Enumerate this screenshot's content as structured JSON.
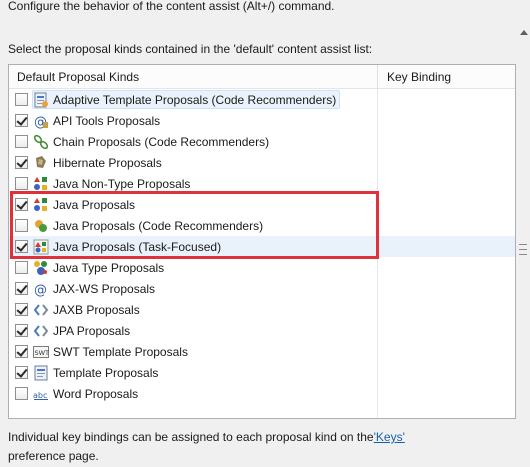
{
  "header_text": "Configure the behavior of the content assist (Alt+/) command.",
  "select_label": "Select the proposal kinds contained in the 'default' content assist list:",
  "columns": {
    "kinds": "Default Proposal Kinds",
    "binding": "Key Binding"
  },
  "proposals": [
    {
      "label": "Adaptive Template Proposals (Code Recommenders)",
      "checked": false,
      "icon": "template-icon"
    },
    {
      "label": "API Tools Proposals",
      "checked": true,
      "icon": "api-tools-icon"
    },
    {
      "label": "Chain Proposals (Code Recommenders)",
      "checked": false,
      "icon": "chain-icon"
    },
    {
      "label": "Hibernate Proposals",
      "checked": true,
      "icon": "hibernate-icon"
    },
    {
      "label": "Java Non-Type Proposals",
      "checked": false,
      "icon": "java-shapes-icon"
    },
    {
      "label": "Java Proposals",
      "checked": true,
      "icon": "java-shapes-icon"
    },
    {
      "label": "Java Proposals (Code Recommenders)",
      "checked": false,
      "icon": "recommenders-icon"
    },
    {
      "label": "Java Proposals (Task-Focused)",
      "checked": true,
      "icon": "task-focused-icon"
    },
    {
      "label": "Java Type Proposals",
      "checked": false,
      "icon": "java-type-icon"
    },
    {
      "label": "JAX-WS Proposals",
      "checked": true,
      "icon": "jaxws-icon"
    },
    {
      "label": "JAXB Proposals",
      "checked": true,
      "icon": "jaxb-icon"
    },
    {
      "label": "JPA Proposals",
      "checked": true,
      "icon": "jpa-icon"
    },
    {
      "label": "SWT Template Proposals",
      "checked": true,
      "icon": "swt-icon"
    },
    {
      "label": "Template Proposals",
      "checked": true,
      "icon": "template-doc-icon"
    },
    {
      "label": "Word Proposals",
      "checked": false,
      "icon": "word-icon"
    }
  ],
  "footer": {
    "text_before": "Individual key bindings can be assigned to each proposal kind on the ",
    "link": "'Keys'",
    "text_after": " preference page."
  },
  "colors": {
    "highlight": "#e0303a",
    "link": "#1a5fb4"
  }
}
